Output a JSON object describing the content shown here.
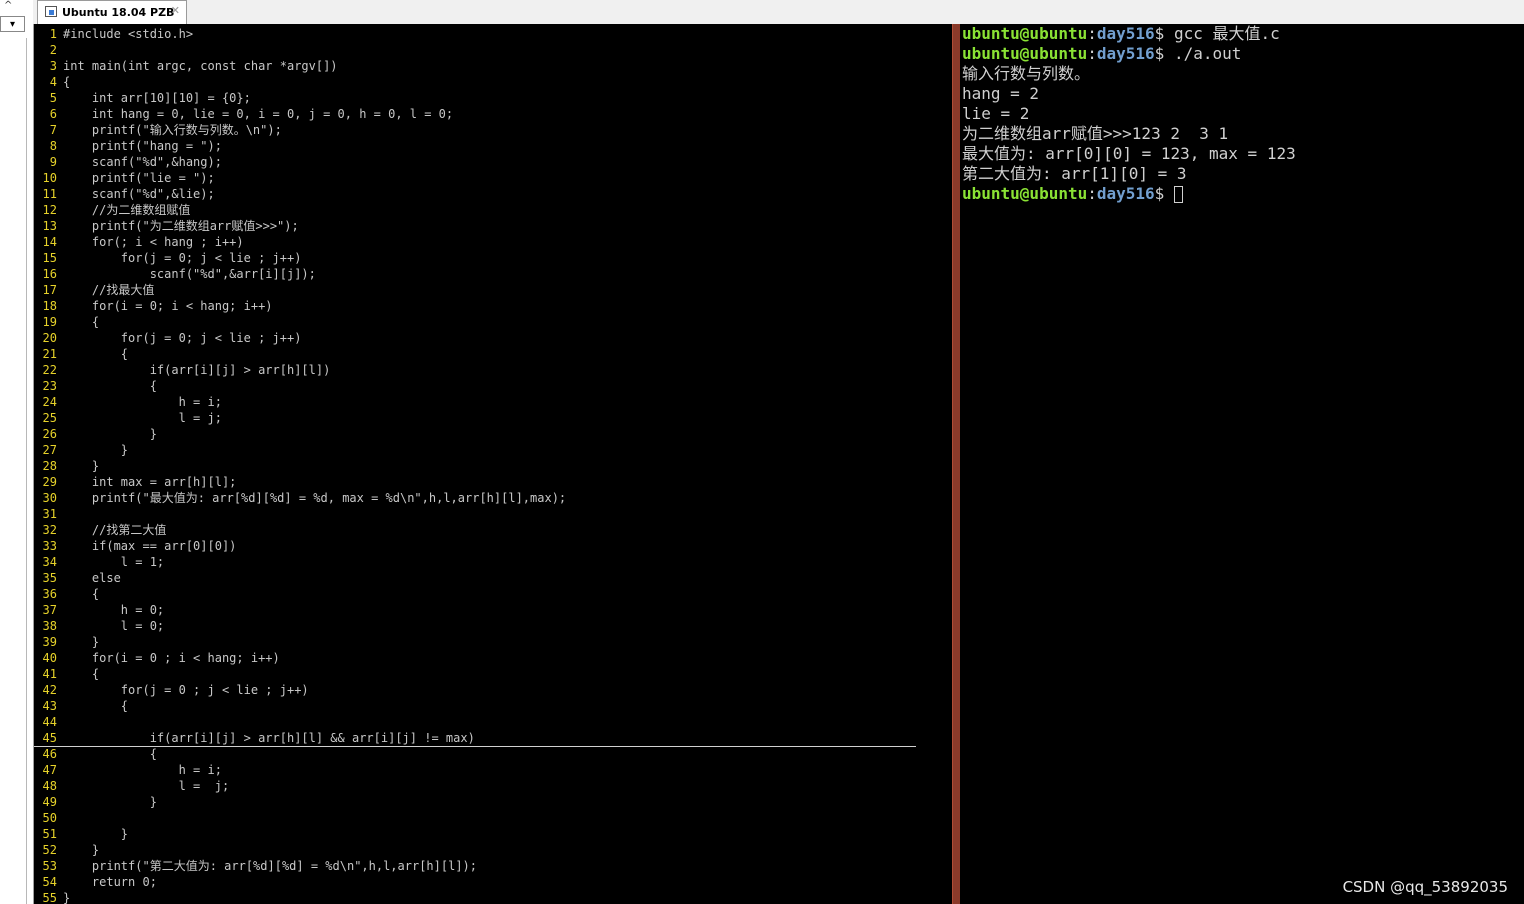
{
  "tab": {
    "title": "Ubuntu 18.04 PZB",
    "close": "✕"
  },
  "editor": {
    "lines": [
      {
        "n": "1",
        "t": "#include <stdio.h>"
      },
      {
        "n": "2",
        "t": ""
      },
      {
        "n": "3",
        "t": "int main(int argc, const char *argv[])"
      },
      {
        "n": "4",
        "t": "{"
      },
      {
        "n": "5",
        "t": "    int arr[10][10] = {0};"
      },
      {
        "n": "6",
        "t": "    int hang = 0, lie = 0, i = 0, j = 0, h = 0, l = 0;"
      },
      {
        "n": "7",
        "t": "    printf(\"输入行数与列数。\\n\");"
      },
      {
        "n": "8",
        "t": "    printf(\"hang = \");"
      },
      {
        "n": "9",
        "t": "    scanf(\"%d\",&hang);"
      },
      {
        "n": "10",
        "t": "    printf(\"lie = \");"
      },
      {
        "n": "11",
        "t": "    scanf(\"%d\",&lie);"
      },
      {
        "n": "12",
        "t": "    //为二维数组赋值"
      },
      {
        "n": "13",
        "t": "    printf(\"为二维数组arr赋值>>>\");"
      },
      {
        "n": "14",
        "t": "    for(; i < hang ; i++)"
      },
      {
        "n": "15",
        "t": "        for(j = 0; j < lie ; j++)"
      },
      {
        "n": "16",
        "t": "            scanf(\"%d\",&arr[i][j]);"
      },
      {
        "n": "17",
        "t": "    //找最大值"
      },
      {
        "n": "18",
        "t": "    for(i = 0; i < hang; i++)"
      },
      {
        "n": "19",
        "t": "    {"
      },
      {
        "n": "20",
        "t": "        for(j = 0; j < lie ; j++)"
      },
      {
        "n": "21",
        "t": "        {"
      },
      {
        "n": "22",
        "t": "            if(arr[i][j] > arr[h][l])"
      },
      {
        "n": "23",
        "t": "            {"
      },
      {
        "n": "24",
        "t": "                h = i;"
      },
      {
        "n": "25",
        "t": "                l = j;"
      },
      {
        "n": "26",
        "t": "            }"
      },
      {
        "n": "27",
        "t": "        }"
      },
      {
        "n": "28",
        "t": "    }"
      },
      {
        "n": "29",
        "t": "    int max = arr[h][l];"
      },
      {
        "n": "30",
        "t": "    printf(\"最大值为: arr[%d][%d] = %d, max = %d\\n\",h,l,arr[h][l],max);"
      },
      {
        "n": "31",
        "t": ""
      },
      {
        "n": "32",
        "t": "    //找第二大值"
      },
      {
        "n": "33",
        "t": "    if(max == arr[0][0])"
      },
      {
        "n": "34",
        "t": "        l = 1;"
      },
      {
        "n": "35",
        "t": "    else"
      },
      {
        "n": "36",
        "t": "    {"
      },
      {
        "n": "37",
        "t": "        h = 0;"
      },
      {
        "n": "38",
        "t": "        l = 0;"
      },
      {
        "n": "39",
        "t": "    }"
      },
      {
        "n": "40",
        "t": "    for(i = 0 ; i < hang; i++)"
      },
      {
        "n": "41",
        "t": "    {"
      },
      {
        "n": "42",
        "t": "        for(j = 0 ; j < lie ; j++)"
      },
      {
        "n": "43",
        "t": "        {"
      },
      {
        "n": "44",
        "t": ""
      },
      {
        "n": "45",
        "t": "            if(arr[i][j] > arr[h][l] && arr[i][j] != max)"
      },
      {
        "n": "46",
        "t": "            {"
      },
      {
        "n": "47",
        "t": "                h = i;"
      },
      {
        "n": "48",
        "t": "                l =  j;"
      },
      {
        "n": "49",
        "t": "            }"
      },
      {
        "n": "50",
        "t": ""
      },
      {
        "n": "51",
        "t": "        }"
      },
      {
        "n": "52",
        "t": "    }"
      },
      {
        "n": "53",
        "t": "    printf(\"第二大值为: arr[%d][%d] = %d\\n\",h,l,arr[h][l]);"
      },
      {
        "n": "54",
        "t": "    return 0;"
      },
      {
        "n": "55",
        "t": "}"
      }
    ],
    "cursor_line": "45"
  },
  "terminal": {
    "prompt_user": "ubuntu@ubuntu",
    "prompt_sep": ":",
    "prompt_path": "day516",
    "prompt_end": "$ ",
    "cmd1": "gcc 最大值.c",
    "cmd2": "./a.out",
    "out1": "输入行数与列数。",
    "out2": "hang = 2",
    "out3": "lie = 2",
    "out4": "为二维数组arr赋值>>>123 2  3 1",
    "out5": "最大值为: arr[0][0] = 123, max = 123",
    "out6": "第二大值为: arr[1][0] = 3"
  },
  "watermark": "CSDN @qq_53892035",
  "colors": {
    "line_number": "#e6d22a",
    "prompt_user": "#8ae234",
    "prompt_path": "#729fcf",
    "divider": "#8a3a2a"
  }
}
